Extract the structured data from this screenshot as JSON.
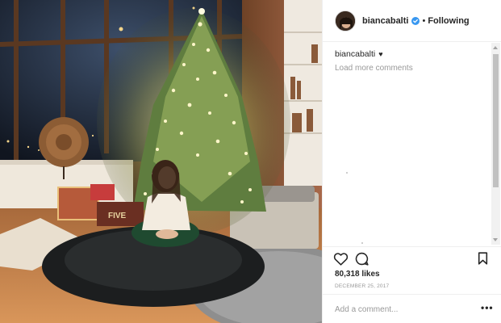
{
  "post": {
    "photo_icon": "photo-christmas-tree-woman",
    "gift_tag_text": "FIVE"
  },
  "header": {
    "username": "biancabalti",
    "verified_icon": "verified-badge-icon",
    "separator": "•",
    "follow_label": "Following"
  },
  "caption": {
    "username": "biancabalti",
    "emoji": "♥"
  },
  "comments": {
    "load_more_label": "Load more comments"
  },
  "actions": {
    "like_icon": "heart-outline-icon",
    "comment_icon": "comment-bubble-icon",
    "save_icon": "bookmark-icon"
  },
  "stats": {
    "likes": "80,318 likes",
    "date": "DECEMBER 25, 2017"
  },
  "comment_box": {
    "placeholder": "Add a comment...",
    "more_label": "•••"
  },
  "colors": {
    "verified_blue": "#3897f0",
    "text": "#262626",
    "muted": "#999999",
    "divider": "#efefef"
  }
}
